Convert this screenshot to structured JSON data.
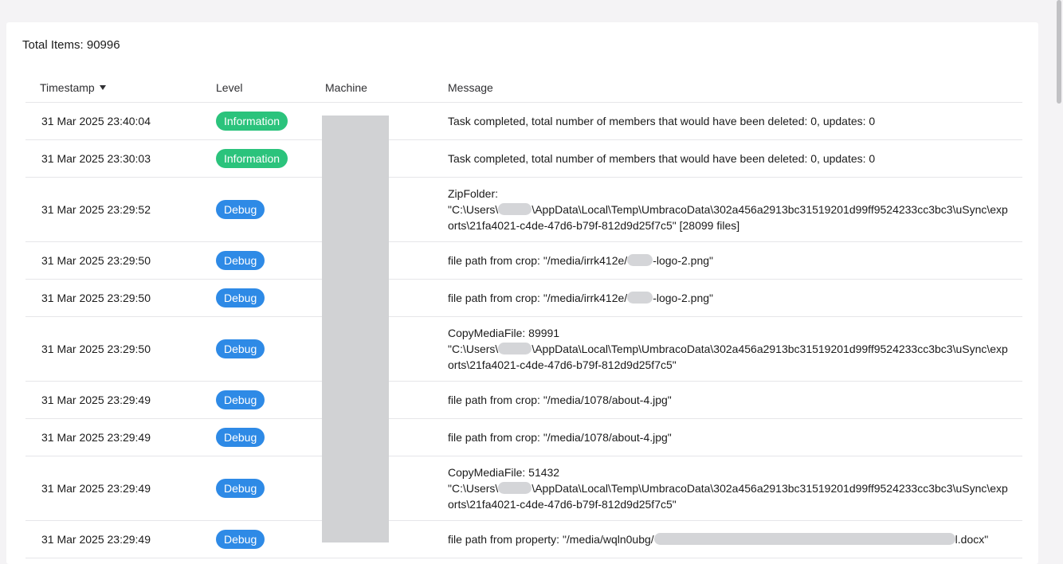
{
  "total": {
    "label": "Total Items: 90996"
  },
  "columns": {
    "timestamp": "Timestamp",
    "level": "Level",
    "machine": "Machine",
    "message": "Message"
  },
  "rows": [
    {
      "timestamp": "31 Mar 2025 23:40:04",
      "level": "Information",
      "message": "Task completed, total number of members that would have been deleted: 0, updates: 0"
    },
    {
      "timestamp": "31 Mar 2025 23:30:03",
      "level": "Information",
      "message": "Task completed, total number of members that would have been deleted: 0, updates: 0"
    },
    {
      "timestamp": "31 Mar 2025 23:29:52",
      "level": "Debug",
      "line1": "ZipFolder:",
      "pre": "\"C:\\Users\\",
      "post": "\\AppData\\Local\\Temp\\UmbracoData\\302a456a2913bc31519201d99ff9524233cc3bc3\\uSync\\exports\\21fa4021-c4de-47d6-b79f-812d9d25f7c5\" [28099 files]"
    },
    {
      "timestamp": "31 Mar 2025 23:29:50",
      "level": "Debug",
      "pre": "file path from crop: \"/media/irrk412e/",
      "post": "-logo-2.png\""
    },
    {
      "timestamp": "31 Mar 2025 23:29:50",
      "level": "Debug",
      "pre": "file path from crop: \"/media/irrk412e/",
      "post": "-logo-2.png\""
    },
    {
      "timestamp": "31 Mar 2025 23:29:50",
      "level": "Debug",
      "line1": "CopyMediaFile: 89991",
      "pre": "\"C:\\Users\\",
      "post": "\\AppData\\Local\\Temp\\UmbracoData\\302a456a2913bc31519201d99ff9524233cc3bc3\\uSync\\exports\\21fa4021-c4de-47d6-b79f-812d9d25f7c5\""
    },
    {
      "timestamp": "31 Mar 2025 23:29:49",
      "level": "Debug",
      "message": "file path from crop: \"/media/1078/about-4.jpg\""
    },
    {
      "timestamp": "31 Mar 2025 23:29:49",
      "level": "Debug",
      "message": "file path from crop: \"/media/1078/about-4.jpg\""
    },
    {
      "timestamp": "31 Mar 2025 23:29:49",
      "level": "Debug",
      "line1": "CopyMediaFile: 51432",
      "pre": "\"C:\\Users\\",
      "post": "\\AppData\\Local\\Temp\\UmbracoData\\302a456a2913bc31519201d99ff9524233cc3bc3\\uSync\\exports\\21fa4021-c4de-47d6-b79f-812d9d25f7c5\""
    },
    {
      "timestamp": "31 Mar 2025 23:29:49",
      "level": "Debug",
      "pre": "file path from property: \"/media/wqln0ubg/",
      "post": "l.docx\""
    }
  ],
  "colors": {
    "information": "#2bc37c",
    "debug": "#2e8ae6",
    "redaction": "#d1d2d4"
  },
  "icons": {
    "sort": "sort-descending-icon"
  }
}
